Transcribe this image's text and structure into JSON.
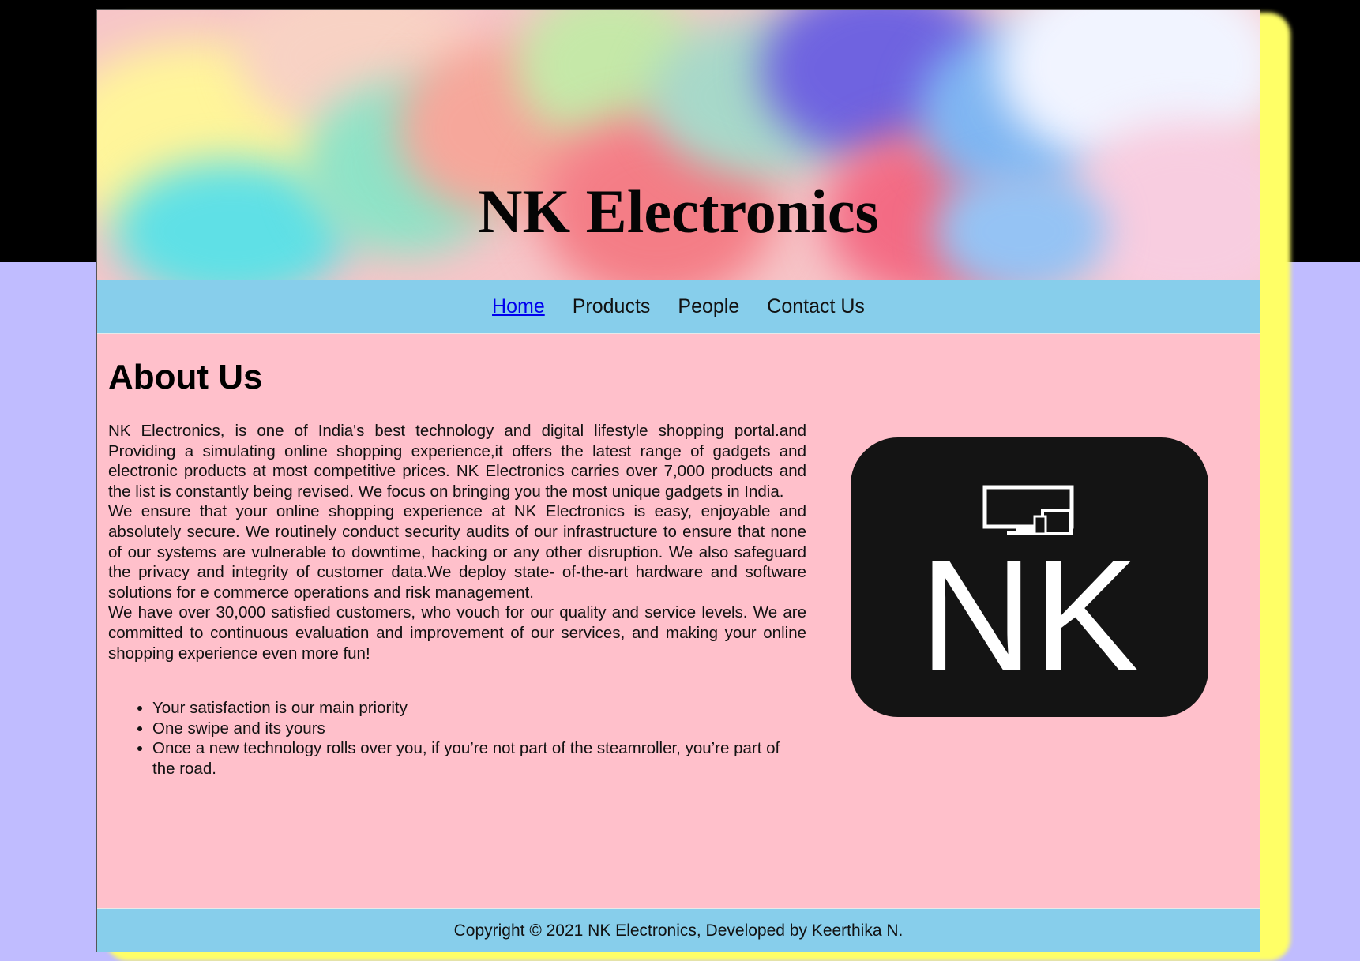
{
  "site": {
    "title": "NK Electronics"
  },
  "nav": {
    "items": [
      {
        "label": "Home",
        "active": true
      },
      {
        "label": "Products",
        "active": false
      },
      {
        "label": "People",
        "active": false
      },
      {
        "label": "Contact Us",
        "active": false
      }
    ]
  },
  "about": {
    "heading": "About Us",
    "paragraphs": [
      "NK Electronics, is one of India's best technology and digital lifestyle shopping portal.and Providing a simulating online shopping experience,it offers the latest range of gadgets and electronic products at most competitive prices. NK Electronics carries over 7,000 products and the list is constantly being revised. We focus on bringing you the most unique gadgets in India.",
      "We ensure that your online shopping experience at NK Electronics is easy, enjoyable and absolutely secure. We routinely conduct security audits of our infrastructure to ensure that none of our systems are vulnerable to downtime, hacking or any other disruption. We also safeguard the privacy and integrity of customer data.We deploy state- of-the-art hardware and software solutions for e commerce operations and risk management.",
      "We have over 30,000 satisfied customers, who vouch for our quality and service levels. We are committed to continuous evaluation and improvement of our services, and making your online shopping experience even more fun!"
    ],
    "bullets": [
      "Your satisfaction is our main priority",
      "One swipe and its yours",
      "Once a new technology rolls over you, if you’re not part of the steamroller, you’re part of the road."
    ]
  },
  "logo": {
    "text": "NK",
    "icon": "devices-icon"
  },
  "footer": {
    "text": "Copyright © 2021 NK Electronics, Developed by Keerthika N."
  },
  "colors": {
    "nav_bg": "#87ceeb",
    "content_bg": "#ffc0cb",
    "page_bg": "#c0bcff",
    "shadow": "#ffff66",
    "link_active": "#0000ee"
  }
}
